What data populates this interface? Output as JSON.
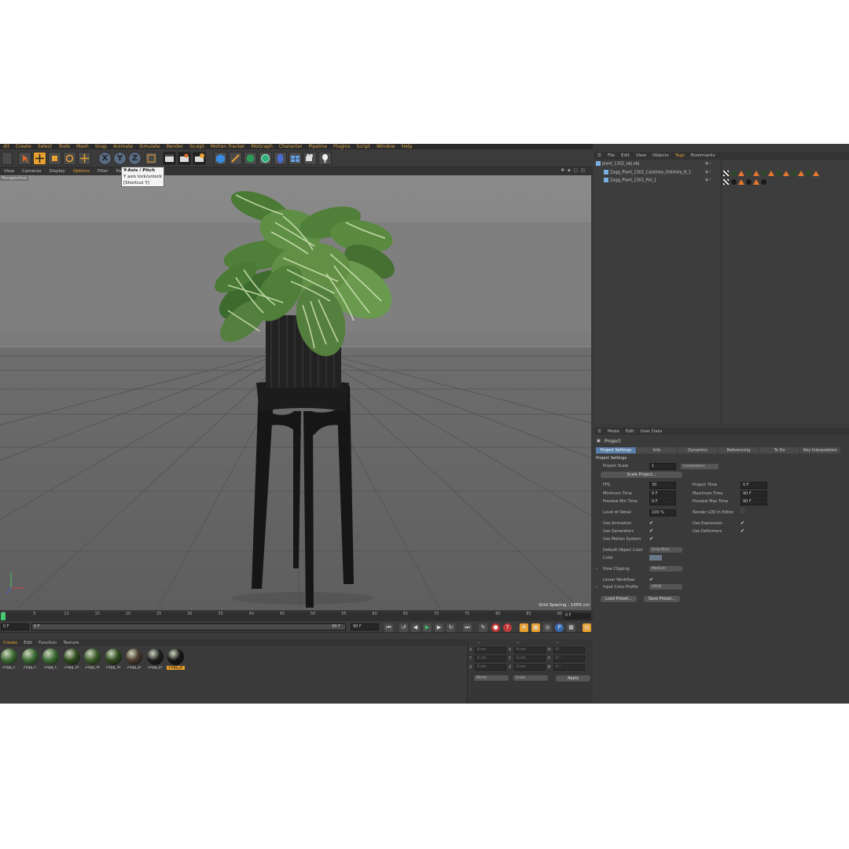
{
  "menubar": [
    "dit",
    "Create",
    "Select",
    "Tools",
    "Mesh",
    "Snap",
    "Animate",
    "Simulate",
    "Render",
    "Sculpt",
    "Motion Tracker",
    "MoGraph",
    "Character",
    "Pipeline",
    "Plugins",
    "Script",
    "Window",
    "Help"
  ],
  "tooltip": {
    "title": "Y-Axis / Pitch",
    "line1": "Y axis lock/unlock",
    "line2": "[Shortcut Y]"
  },
  "axis_buttons": {
    "x": "X",
    "y": "Y",
    "z": "Z"
  },
  "viewport_menu": [
    "View",
    "Cameras",
    "Display",
    "Options",
    "Filter",
    "Panel"
  ],
  "viewport_active": "Options",
  "viewport": {
    "label": "Perspective",
    "grid_spacing": "Grid Spacing : 1000 cm"
  },
  "timeline": {
    "ticks": [
      "0",
      "5",
      "10",
      "15",
      "20",
      "25",
      "30",
      "35",
      "40",
      "45",
      "50",
      "55",
      "60",
      "65",
      "70",
      "75",
      "80",
      "85",
      "90"
    ],
    "end_frame": "0 F",
    "current_frame": "0 F",
    "range_start": "0 F",
    "range_end": "90 F",
    "max_field": "90 F"
  },
  "material_menu": [
    "Create",
    "Edit",
    "Function",
    "Texture"
  ],
  "material_active": "Create",
  "materials": [
    {
      "label": "Zagg_C",
      "color": "#3c6a34"
    },
    {
      "label": "Zagg_C",
      "color": "#3c6a34"
    },
    {
      "label": "Zagg_C",
      "color": "#3c6a34"
    },
    {
      "label": "Zagg_St",
      "color": "#2e4a1e"
    },
    {
      "label": "Zagg_St",
      "color": "#3a5a2a"
    },
    {
      "label": "Zagg_St",
      "color": "#2e4a1e"
    },
    {
      "label": "Zagg_pl",
      "color": "#4a3a2e"
    },
    {
      "label": "Zagg_pl",
      "color": "#1e1e1e"
    },
    {
      "label": "Zagg_pl",
      "color": "#141414"
    }
  ],
  "coords": {
    "headers": [
      "--",
      "--",
      "--"
    ],
    "rows": [
      {
        "a": "X",
        "av": "0 cm",
        "b": "X",
        "bv": "0 cm",
        "c": "H",
        "cv": "0 °"
      },
      {
        "a": "Y",
        "av": "0 cm",
        "b": "Y",
        "bv": "0 cm",
        "c": "P",
        "cv": "0 °"
      },
      {
        "a": "Z",
        "av": "0 cm",
        "b": "Z",
        "bv": "0 cm",
        "c": "B",
        "cv": "0 °"
      }
    ],
    "world": "World",
    "scale": "Scale",
    "apply": "Apply"
  },
  "object_menu": [
    "File",
    "Edit",
    "View",
    "Objects",
    "Tags",
    "Bookmarks"
  ],
  "object_active": "Tags",
  "objects": [
    {
      "label": "plant_1302_obj.obj",
      "indent": 0
    },
    {
      "label": "Zagg_Plant_1302_Calathea_Orbifolia_B_1",
      "indent": 1
    },
    {
      "label": "Zagg_Plant_1302_Pot_1",
      "indent": 1
    }
  ],
  "attr_menu": [
    "Mode",
    "Edit",
    "User Data"
  ],
  "attr": {
    "title": "Project",
    "tabs": [
      "Project Settings",
      "Info",
      "Dynamics",
      "Referencing",
      "To Do",
      "Key Interpolation"
    ],
    "section": "Project Settings",
    "project_scale_label": "Project Scale",
    "project_scale_value": "1",
    "project_scale_unit": "Centimeters",
    "scale_project": "Scale Project...",
    "fps_label": "FPS",
    "fps_value": "30",
    "project_time_label": "Project Time",
    "project_time_value": "0 F",
    "min_time_label": "Minimum Time",
    "min_time_value": "0 F",
    "max_time_label": "Maximum Time",
    "max_time_value": "90 F",
    "prev_min_label": "Preview Min Time",
    "prev_min_value": "0 F",
    "prev_max_label": "Preview Max Time",
    "prev_max_value": "90 F",
    "lod_label": "Level of Detail",
    "lod_value": "100 %",
    "render_lod_label": "Render LOD in Editor",
    "use_animation": "Use Animation",
    "use_expression": "Use Expression",
    "use_generators": "Use Generators",
    "use_deformers": "Use Deformers",
    "use_motion": "Use Motion System",
    "default_color_label": "Default Object Color",
    "default_color_value": "Gray-Blue",
    "color_label": "Color",
    "view_clipping_label": "View Clipping",
    "view_clipping_value": "Medium",
    "linear_workflow_label": "Linear Workflow",
    "input_profile_label": "Input Color Profile",
    "input_profile_value": "sRGB",
    "load_preset": "Load Preset...",
    "save_preset": "Save Preset...",
    "check": "✔"
  }
}
